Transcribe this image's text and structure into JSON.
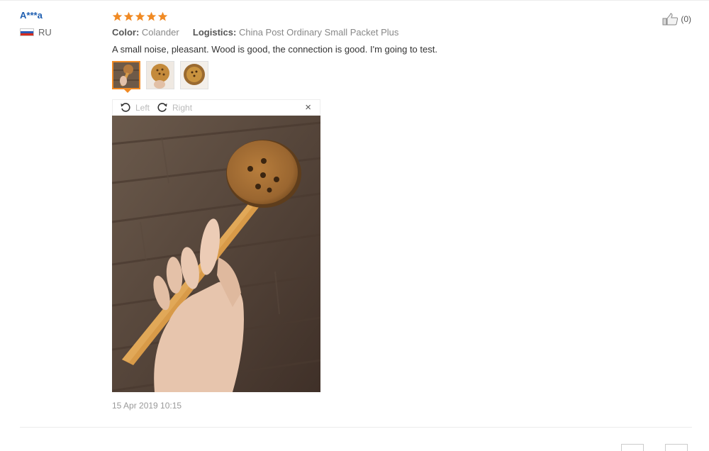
{
  "reviewer": {
    "name": "A***a",
    "country_code": "RU",
    "flag_icon": "russia-flag-icon"
  },
  "rating": {
    "stars": 5,
    "max": 5,
    "color": "#f08a24"
  },
  "meta": {
    "color_label": "Color:",
    "color_value": "Colander",
    "logistics_label": "Logistics:",
    "logistics_value": "China Post Ordinary Small Packet Plus"
  },
  "review_text": "A small noise, pleasant. Wood is good, the connection is good. I'm going to test.",
  "helpful": {
    "icon": "thumbs-up-icon",
    "count": "(0)"
  },
  "thumbnails": [
    {
      "name": "thumb-1",
      "active": true
    },
    {
      "name": "thumb-2",
      "active": false
    },
    {
      "name": "thumb-3",
      "active": false
    }
  ],
  "viewer": {
    "rotate_left_label": "Left",
    "rotate_right_label": "Right",
    "close_label": "×"
  },
  "date": "15 Apr 2019 10:15",
  "colors": {
    "accent": "#f08a24",
    "link": "#1f5fb1"
  }
}
